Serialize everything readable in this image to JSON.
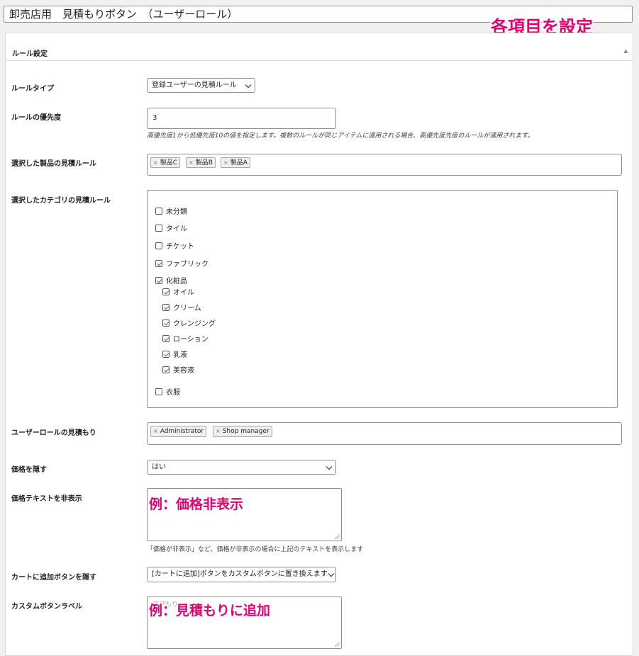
{
  "post_title": "卸売店用　見積もりボタン　（ユーザーロール）",
  "annotation_top": "各項目を設定",
  "panel": {
    "header": "ルール設定",
    "collapse_arrow": "▲"
  },
  "rule_type": {
    "label": "ルールタイプ",
    "value": "登録ユーザーの見積ルール"
  },
  "priority": {
    "label": "ルールの優先度",
    "value": "3",
    "description": "高優先度1から低優先度10の値を指定します。複数のルールが同じアイテムに適用される場合、高優先度先度のルールが適用されます。"
  },
  "products": {
    "label": "選択した製品の見積ルール",
    "tags": [
      "製品C",
      "製品B",
      "製品A"
    ]
  },
  "categories": {
    "label": "選択したカテゴリの見積ルール",
    "items": [
      {
        "label": "未分類",
        "checked": false,
        "child": false
      },
      {
        "label": "タイル",
        "checked": false,
        "child": false
      },
      {
        "label": "チケット",
        "checked": false,
        "child": false
      },
      {
        "label": "ファブリック",
        "checked": true,
        "child": false
      },
      {
        "label": "化粧品",
        "checked": true,
        "child": false
      },
      {
        "label": "オイル",
        "checked": true,
        "child": true
      },
      {
        "label": "クリーム",
        "checked": true,
        "child": true
      },
      {
        "label": "クレンジング",
        "checked": true,
        "child": true
      },
      {
        "label": "ローション",
        "checked": true,
        "child": true
      },
      {
        "label": "乳液",
        "checked": true,
        "child": true
      },
      {
        "label": "美容液",
        "checked": true,
        "child": true
      },
      {
        "label": "衣服",
        "checked": false,
        "child": false
      }
    ]
  },
  "roles": {
    "label": "ユーザーロールの見積もり",
    "tags": [
      "Administrator",
      "Shop manager"
    ]
  },
  "hide_price": {
    "label": "価格を隠す",
    "value": "はい"
  },
  "hide_price_text": {
    "label": "価格テキストを非表示",
    "annotation": "例：価格非表示",
    "description": "「価格が非表示」など、価格が非表示の場合に上記のテキストを表示します"
  },
  "hide_cart_button": {
    "label": "カートに追加ボタンを隠す",
    "value": "[カートに追加]ボタンをカスタムボタンに置き換えます"
  },
  "custom_button_label": {
    "label": "カスタムボタンラベル",
    "placeholder": "見積もり",
    "annotation": "例：見積もりに追加"
  },
  "tag_remove_glyph": "×",
  "icons": {
    "tag_remove": "close-icon",
    "select_arrow": "chevron-down-icon",
    "resize": "resize-grip-icon",
    "checkbox_check": "check-icon"
  },
  "colors": {
    "annotation": "#e6006f",
    "checkbox_check": "#2271b1",
    "border": "#8c8f94"
  }
}
